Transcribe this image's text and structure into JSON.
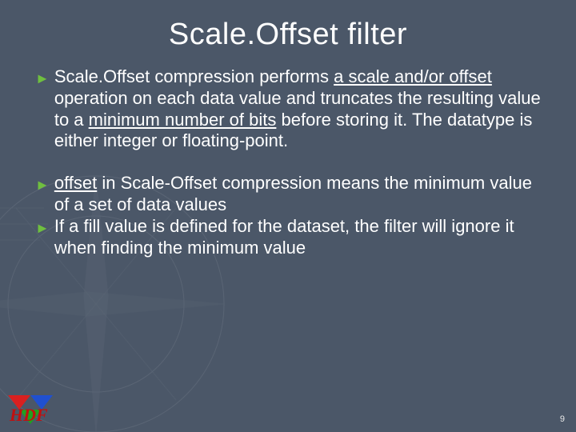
{
  "title": "Scale.Offset filter",
  "bullets": [
    {
      "segments": [
        {
          "t": "Scale.Offset compression performs "
        },
        {
          "t": "a scale and/or offset",
          "u": true
        },
        {
          "t": " operation on each data value and truncates the resulting value to a "
        },
        {
          "t": "minimum number of bits",
          "u": true
        },
        {
          "t": " before storing it. The datatype is either integer or floating-point."
        }
      ]
    },
    {
      "segments": [
        {
          "t": "offset",
          "u": true
        },
        {
          "t": " in Scale-Offset compression means the minimum value of a set of data values"
        }
      ]
    },
    {
      "segments": [
        {
          "t": "If a fill value is defined for the dataset, the filter will ignore it when finding the minimum value"
        }
      ]
    }
  ],
  "page_number": "9",
  "logo_text": "HDF",
  "icons": {
    "bullet_arrow": "►"
  }
}
